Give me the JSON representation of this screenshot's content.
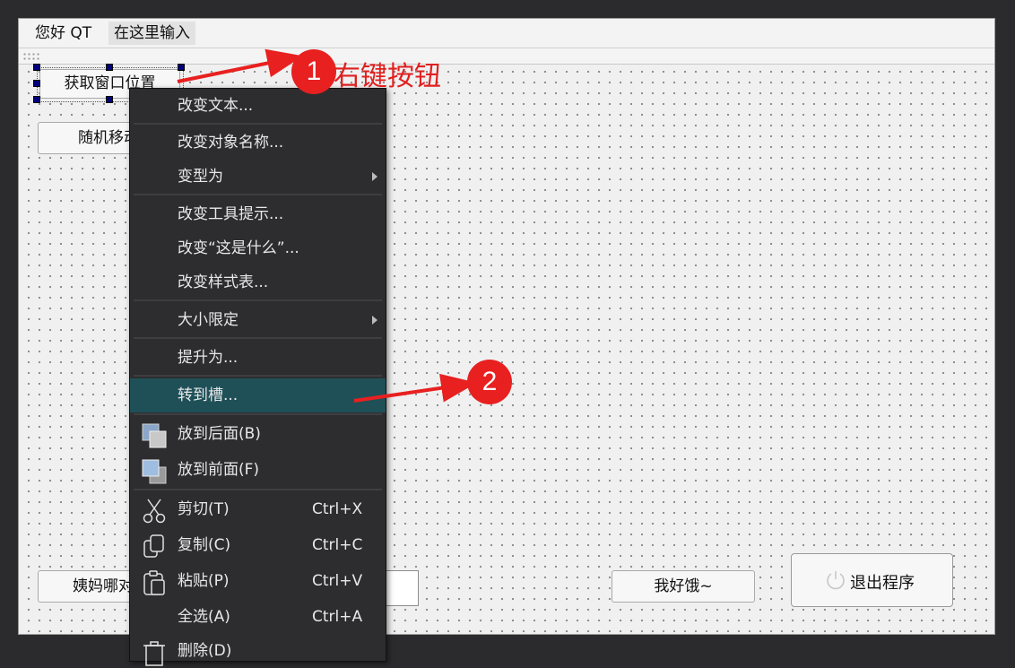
{
  "menubar": {
    "items": [
      "您好 QT",
      "在这里输入"
    ]
  },
  "form": {
    "get_pos_button": "获取窗口位置",
    "random_move_button": "随机移动",
    "aunt_button": "姨妈哪对",
    "hungry_button": "我好饿~",
    "exit_button": "退出程序"
  },
  "context_menu": {
    "change_text": "改变文本...",
    "change_object_name": "改变对象名称...",
    "morph_into": "变型为",
    "change_tooltip": "改变工具提示...",
    "change_whats_this": "改变“这是什么”...",
    "change_stylesheet": "改变样式表...",
    "size_constraints": "大小限定",
    "promote_to": "提升为...",
    "go_to_slot": "转到槽...",
    "send_to_back": "放到后面(B)",
    "bring_to_front": "放到前面(F)",
    "cut": "剪切(T)",
    "cut_shortcut": "Ctrl+X",
    "copy": "复制(C)",
    "copy_shortcut": "Ctrl+C",
    "paste": "粘贴(P)",
    "paste_shortcut": "Ctrl+V",
    "select_all": "全选(A)",
    "select_all_shortcut": "Ctrl+A",
    "delete": "删除(D)"
  },
  "annotations": {
    "step1": "1",
    "step1_text": "右键按钮",
    "step2": "2",
    "color": "#e82020"
  }
}
